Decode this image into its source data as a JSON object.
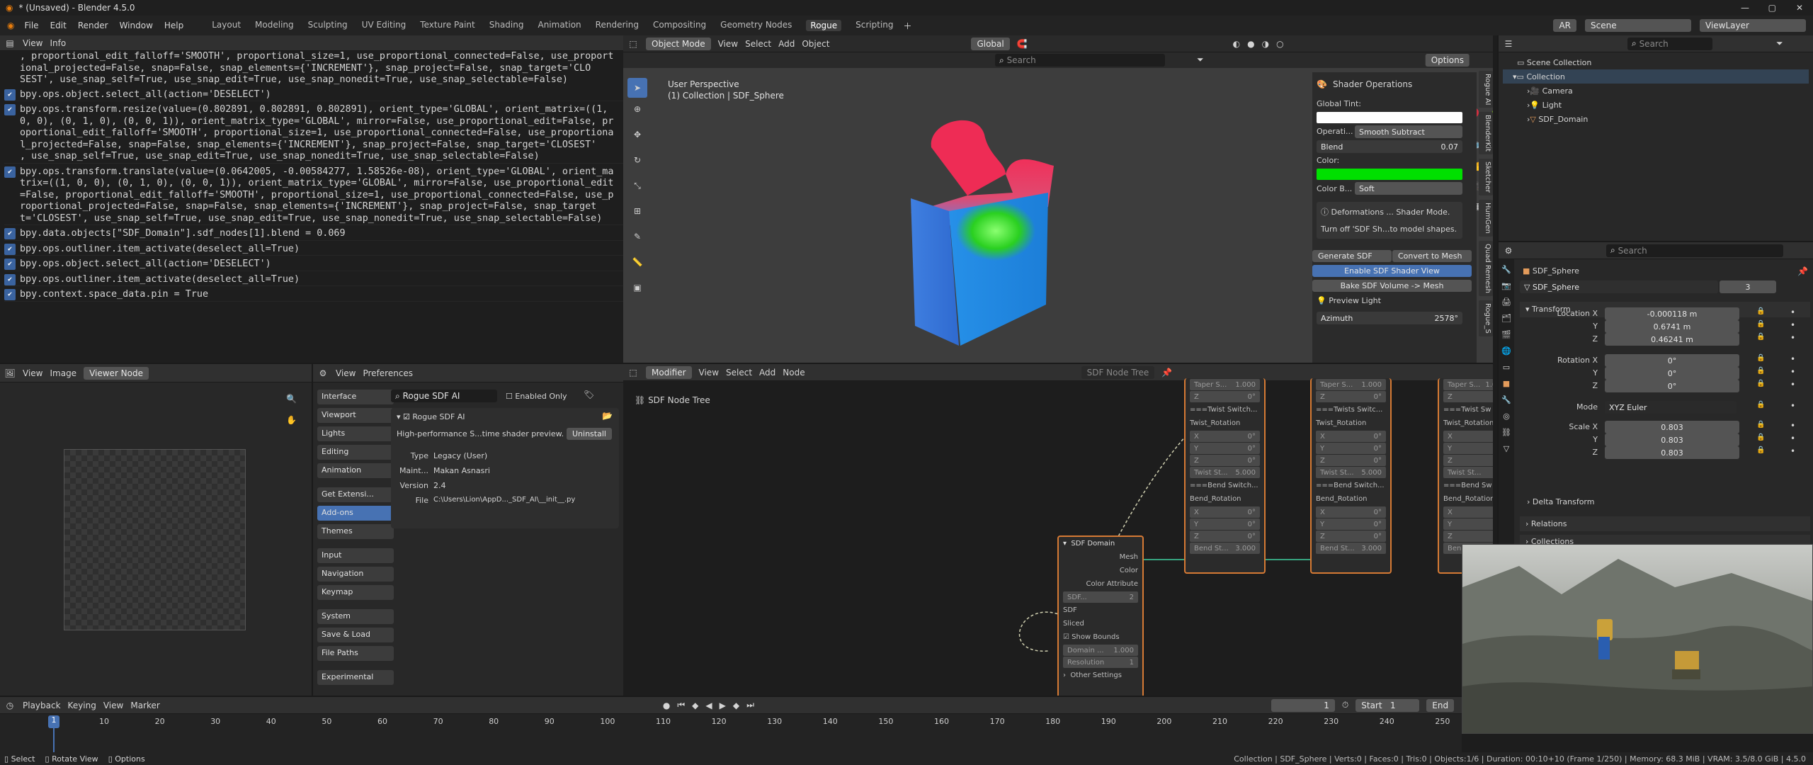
{
  "window": {
    "title": "* (Unsaved) - Blender 4.5.0"
  },
  "menus": [
    "File",
    "Edit",
    "Render",
    "Window",
    "Help"
  ],
  "workspaces": [
    "Layout",
    "Modeling",
    "Sculpting",
    "UV Editing",
    "Texture Paint",
    "Shading",
    "Animation",
    "Rendering",
    "Compositing",
    "Geometry Nodes",
    "Rogue",
    "Scripting"
  ],
  "active_workspace": "Rogue",
  "topright": {
    "lang": "AR",
    "scene": "Scene",
    "viewlayer": "ViewLayer"
  },
  "info": {
    "menus": [
      "View",
      "Info"
    ],
    "lines": [
      ", proportional_edit_falloff='SMOOTH', proportional_size=1, use_proportional_connected=False, use_proport",
      "ional_projected=False, snap=False, snap_elements={'INCREMENT'}, snap_project=False, snap_target='CLO",
      "SEST', use_snap_self=True, use_snap_edit=True, use_snap_nonedit=True, use_snap_selectable=False)"
    ],
    "entries": [
      {
        "lines": [
          "bpy.ops.object.select_all(action='DESELECT')"
        ]
      },
      {
        "lines": [
          "bpy.ops.transform.resize(value=(0.802891, 0.802891, 0.802891), orient_type='GLOBAL', orient_matrix=((1,",
          "0, 0), (0, 1, 0), (0, 0, 1)), orient_matrix_type='GLOBAL', mirror=False, use_proportional_edit=False, pr",
          "oportional_edit_falloff='SMOOTH', proportional_size=1, use_proportional_connected=False, use_proportiona",
          "l_projected=False, snap=False, snap_elements={'INCREMENT'}, snap_project=False, snap_target='CLOSEST'",
          ", use_snap_self=True, use_snap_edit=True, use_snap_nonedit=True, use_snap_selectable=False)"
        ]
      },
      {
        "lines": [
          "bpy.ops.transform.translate(value=(0.0642005, -0.00584277, 1.58526e-08), orient_type='GLOBAL', orient_ma",
          "trix=((1, 0, 0), (0, 1, 0), (0, 0, 1)), orient_matrix_type='GLOBAL', mirror=False, use_proportional_edit",
          "=False, proportional_edit_falloff='SMOOTH', proportional_size=1, use_proportional_connected=False, use_p",
          "roportional_projected=False, snap=False, snap_elements={'INCREMENT'}, snap_project=False, snap_target",
          "t='CLOSEST', use_snap_self=True, use_snap_edit=True, use_snap_nonedit=True, use_snap_selectable=False)"
        ]
      },
      {
        "lines": [
          "bpy.data.objects[\"SDF_Domain\"].sdf_nodes[1].blend = 0.069"
        ]
      },
      {
        "lines": [
          "bpy.ops.outliner.item_activate(deselect_all=True)"
        ]
      },
      {
        "lines": [
          "bpy.ops.object.select_all(action='DESELECT')"
        ]
      },
      {
        "lines": [
          "bpy.ops.outliner.item_activate(deselect_all=True)"
        ]
      },
      {
        "lines": [
          "bpy.context.space_data.pin = True"
        ]
      }
    ]
  },
  "viewport": {
    "mode": "Object Mode",
    "menus": [
      "View",
      "Select",
      "Add",
      "Object"
    ],
    "orientation": "Global",
    "options": "Options",
    "search_placeholder": "Search",
    "persp": "User Perspective",
    "collection": "(1) Collection | SDF_Sphere",
    "tabs": [
      "Rogue AI",
      "BlenderKit",
      "Sketcher",
      "HumGen",
      "Quad Remesh",
      "Rogue_S"
    ]
  },
  "shader_panel": {
    "title": "Shader Operations",
    "tint_label": "Global Tint:",
    "op_label": "Operati...",
    "op_value": "Smooth Subtract",
    "blend_label": "Blend",
    "blend_value": "0.07",
    "color_label": "Color:",
    "colorb_label": "Color B...",
    "colorb_value": "Soft",
    "info1": "Deformations ... Shader Mode.",
    "info2": "Turn off 'SDF Sh...to model shapes.",
    "gen": "Generate SDF",
    "convert": "Convert to Mesh",
    "enable": "Enable SDF Shader View",
    "bake": "Bake SDF Volume -> Mesh",
    "preview": "Preview Light",
    "azimuth_label": "Azimuth",
    "azimuth_value": "2578°",
    "accent": "#4772b3",
    "tint": "#ffffff",
    "color": "#00e000"
  },
  "image_editor": {
    "menus": [
      "View",
      "Image"
    ],
    "viewer": "Viewer Node"
  },
  "prefs": {
    "menus": [
      "View",
      "Preferences"
    ],
    "search": "Rogue SDF AI",
    "enabled_only": "Enabled Only",
    "sidebar": [
      "Interface",
      "Viewport",
      "Lights",
      "Editing",
      "Animation",
      "Get Extensi...",
      "Add-ons",
      "Themes",
      "Input",
      "Navigation",
      "Keymap",
      "System",
      "Save & Load",
      "File Paths",
      "Experimental"
    ],
    "active": "Add-ons",
    "addon": {
      "name": "Rogue SDF AI",
      "desc": "High-performance S...time shader preview.",
      "uninstall": "Uninstall",
      "type_label": "Type",
      "type": "Legacy (User)",
      "maint_label": "Maint...",
      "maint": "Makan Asnasri",
      "version_label": "Version",
      "version": "2.4",
      "file_label": "File",
      "file": "C:\\Users\\Lion\\AppD..._SDF_AI\\__init__.py"
    }
  },
  "node_editor": {
    "editor": "Modifier",
    "menus": [
      "View",
      "Select",
      "Add",
      "Node"
    ],
    "tree": "SDF Node Tree",
    "breadcrumb": "SDF Node Tree",
    "domain": {
      "title": "SDF Domain",
      "out": [
        "Mesh",
        "Color",
        "Color Attribute"
      ],
      "sdf_field": "SDF...",
      "sdf_num": "2",
      "in": [
        "SDF",
        "Sliced"
      ],
      "show_bounds": "Show Bounds",
      "domain_label": "Domain ...",
      "domain_value": "1.000",
      "res_label": "Resolution",
      "res_value": "1",
      "other": "Other Settings"
    },
    "columns": [
      {
        "z": "0°",
        "twist_switch": "===Twist Switch...",
        "twist_rot": "Twist_Rotation",
        "x": "0°",
        "y": "0°",
        "z2": "0°",
        "taper": "1.000",
        "twist_s": "5.000",
        "bend_switch": "===Bend Switch...",
        "bend_rot": "Bend_Rotation",
        "bx": "0°",
        "by": "0°",
        "bz": "0°",
        "bend_s": "3.000"
      },
      {
        "z": "0°",
        "twist_switch": "===Twists Switc...",
        "twist_rot": "Twist_Rotation",
        "x": "0°",
        "y": "0°",
        "z2": "0°",
        "taper": "1.000",
        "twist_s": "5.000",
        "bend_switch": "===Bend Switch...",
        "bend_rot": "Bend_Rotation",
        "bx": "0°",
        "by": "0°",
        "bz": "0°",
        "bend_s": "3.000"
      },
      {
        "z": "0°",
        "twist_switch": "===Twist Sw",
        "twist_rot": "Twist_Rotation",
        "x": "0°",
        "y": "0°",
        "z2": "0°",
        "taper": "1.000",
        "twist_s": "5.0",
        "bend_switch": "===Bend Sw",
        "bend_rot": "Bend_Rotation",
        "bx": "0°",
        "by": "0°",
        "bz": "0°",
        "bend_s": "3.0"
      }
    ],
    "labels": {
      "taper": "Taper S...",
      "twist": "Twist St...",
      "bend": "Bend St...",
      "x": "X",
      "y": "Y",
      "z": "Z"
    }
  },
  "outliner": {
    "search": "Search",
    "items": [
      {
        "name": "Scene Collection"
      },
      {
        "name": "Collection"
      },
      {
        "name": "Camera"
      },
      {
        "name": "Light"
      },
      {
        "name": "SDF_Domain"
      }
    ]
  },
  "properties": {
    "search": "Search",
    "object": "SDF_Sphere",
    "datablock": "SDF_Sphere",
    "users": "3",
    "transform": "Transform",
    "location": {
      "label": "Location X",
      "x": "-0.000118 m",
      "y": "0.6741 m",
      "z": "0.46241 m"
    },
    "rotation": {
      "label": "Rotation X",
      "x": "0°",
      "y": "0°",
      "z": "0°"
    },
    "mode_label": "Mode",
    "mode": "XYZ Euler",
    "scale": {
      "label": "Scale X",
      "x": "0.803",
      "y": "0.803",
      "z": "0.803"
    },
    "axes": {
      "y": "Y",
      "z": "Z"
    },
    "delta": "Delta Transform",
    "relations": "Relations",
    "collections": "Collections"
  },
  "timeline": {
    "menus": [
      "Playback",
      "Keying",
      "View",
      "Marker"
    ],
    "frame": "1",
    "start_label": "Start",
    "start": "1",
    "end_label": "End",
    "current": "1",
    "ticks": [
      "10",
      "20",
      "30",
      "40",
      "50",
      "60",
      "70",
      "80",
      "90",
      "100",
      "110",
      "120",
      "130",
      "140",
      "150",
      "160",
      "170",
      "180",
      "190",
      "200",
      "210",
      "220",
      "230",
      "240",
      "250"
    ]
  },
  "status": {
    "select": "Select",
    "rotate": "Rotate View",
    "options": "Options",
    "info": "Collection | SDF_Sphere | Verts:0 | Faces:0 | Tris:0 | Objects:1/6 | Duration: 00:10+10 (Frame 1/250) | Memory: 68.3 MiB | VRAM: 3.5/8.0 GiB | 4.5.0"
  }
}
